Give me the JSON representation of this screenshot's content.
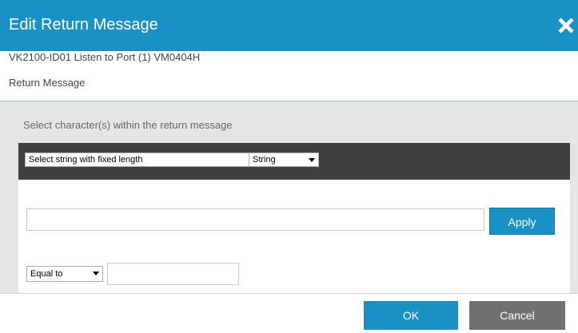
{
  "dialog": {
    "title": "Edit Return Message",
    "close_icon": "close-icon"
  },
  "info": {
    "device": "VK2100-ID01 Listen to Port (1) VM0404H",
    "section_label": "Return Message"
  },
  "panel": {
    "instruction": "Select character(s) within the return message",
    "selection_mode": "Select string with fixed length",
    "data_type": "String",
    "text_value": "",
    "apply_label": "Apply",
    "compare_operator": "Equal to",
    "compare_value": ""
  },
  "footer": {
    "ok_label": "OK",
    "cancel_label": "Cancel"
  },
  "colors": {
    "accent": "#1a91c4",
    "toolbar": "#404040",
    "panel_bg": "#e5e5e5",
    "cancel": "#707070"
  }
}
